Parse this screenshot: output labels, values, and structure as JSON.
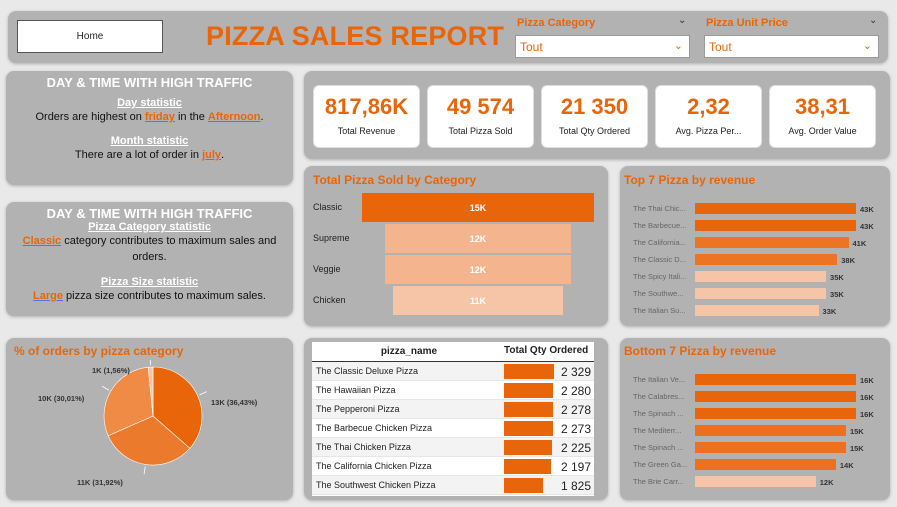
{
  "header": {
    "home_label": "Home",
    "title": "PIZZA SALES REPORT"
  },
  "slicers": [
    {
      "label": "Pizza Category",
      "value": "Tout"
    },
    {
      "label": "Pizza Unit Price",
      "value": "Tout"
    }
  ],
  "traffic_panel_1": {
    "title": "DAY & TIME WITH HIGH TRAFFIC",
    "day_head": "Day statistic",
    "day_pre": "Orders are highest on ",
    "day_hl1": "friday",
    "day_mid": " in the ",
    "day_hl2": "Afternoon",
    "day_post": ".",
    "month_head": "Month statistic",
    "month_pre": "There are a lot of order in ",
    "month_hl": "july",
    "month_post": "."
  },
  "traffic_panel_2": {
    "title": "DAY & TIME WITH HIGH TRAFFIC",
    "cat_head": "Pizza Category statistic",
    "cat_hl": "Classic",
    "cat_text": " category contributes to maximum sales and",
    "cat_text2": "orders.",
    "size_head": "Pizza Size statistic",
    "size_hl": "Large",
    "size_text": " pizza size contributes to maximum sales."
  },
  "kpis": [
    {
      "value": "817,86K",
      "label": "Total Revenue"
    },
    {
      "value": "49 574",
      "label": "Total Pizza Sold"
    },
    {
      "value": "21 350",
      "label": "Total Qty Ordered"
    },
    {
      "value": "2,32",
      "label": "Avg. Pizza Per..."
    },
    {
      "value": "38,31",
      "label": "Avg. Order Value"
    }
  ],
  "colors": {
    "accent": "#e8650a",
    "light1": "#f3b48e",
    "light2": "#f6c4a7",
    "panel": "#b2b2b2"
  },
  "chart_data": [
    {
      "type": "bar",
      "title": "Total Pizza Sold by Category",
      "categories": [
        "Classic",
        "Supreme",
        "Veggie",
        "Chicken"
      ],
      "values": [
        15,
        12,
        12,
        11
      ],
      "value_labels": [
        "15K",
        "12K",
        "12K",
        "11K"
      ]
    },
    {
      "type": "bar",
      "title": "Top 7 Pizza by revenue",
      "categories": [
        "The Thai Chic...",
        "The Barbecue...",
        "The California...",
        "The Classic D...",
        "The Spicy Itali...",
        "The Southwe...",
        "The Italian Su..."
      ],
      "values": [
        43,
        43,
        41,
        38,
        35,
        35,
        33
      ],
      "value_labels": [
        "43K",
        "43K",
        "41K",
        "38K",
        "35K",
        "35K",
        "33K"
      ]
    },
    {
      "type": "bar",
      "title": "Bottom 7 Pizza by revenue",
      "categories": [
        "The Italian Ve...",
        "The Calabres...",
        "The Spinach ...",
        "The Mediterr...",
        "The Spinach ...",
        "The Green Ga...",
        "The Brie Carr..."
      ],
      "values": [
        16,
        16,
        16,
        15,
        15,
        14,
        12
      ],
      "value_labels": [
        "16K",
        "16K",
        "16K",
        "15K",
        "15K",
        "14K",
        "12K"
      ]
    },
    {
      "type": "pie",
      "title": "% of orders by pizza category",
      "labels": [
        "13K (36,43%)",
        "11K (31,92%)",
        "10K (30,01%)",
        "1K (1,56%)"
      ],
      "values": [
        36.43,
        31.92,
        30.01,
        1.56
      ]
    },
    {
      "type": "table",
      "columns": [
        "pizza_name",
        "Total Qty Ordered"
      ],
      "rows": [
        [
          "The Classic Deluxe Pizza",
          2329,
          "2 329"
        ],
        [
          "The Hawaiian Pizza",
          2280,
          "2 280"
        ],
        [
          "The Pepperoni Pizza",
          2278,
          "2 278"
        ],
        [
          "The Barbecue Chicken Pizza",
          2273,
          "2 273"
        ],
        [
          "The Thai Chicken Pizza",
          2225,
          "2 225"
        ],
        [
          "The California Chicken Pizza",
          2197,
          "2 197"
        ],
        [
          "The Southwest Chicken Pizza",
          1825,
          "1 825"
        ]
      ]
    }
  ]
}
